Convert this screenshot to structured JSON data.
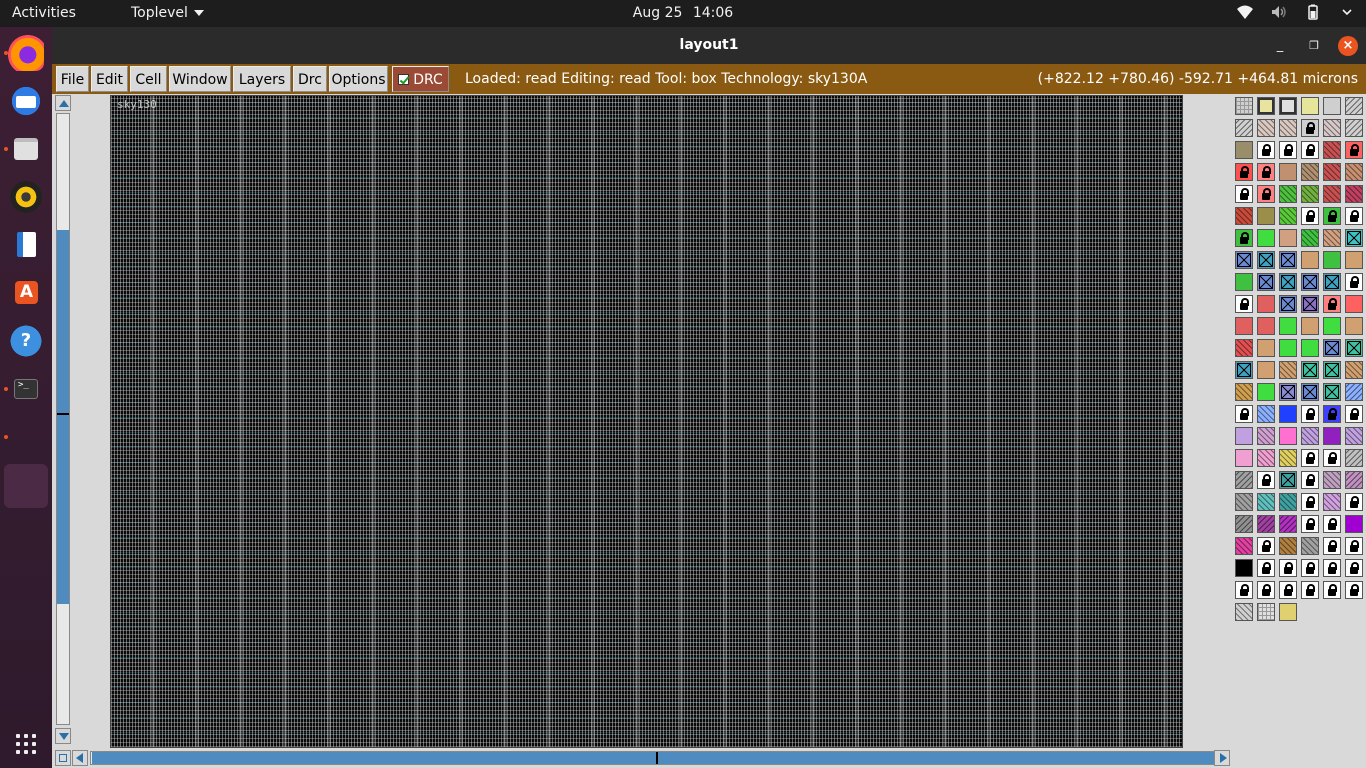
{
  "topbar": {
    "activities": "Activities",
    "app_menu": "Toplevel",
    "date": "Aug 25",
    "time": "14:06",
    "tray_icons": [
      "wifi-icon",
      "volume-icon",
      "battery-icon",
      "power-menu-icon"
    ]
  },
  "dock": {
    "items": [
      {
        "name": "firefox",
        "color": "#ff7139",
        "running": true
      },
      {
        "name": "thunderbird",
        "color": "#3a7bd5",
        "running": false
      },
      {
        "name": "files",
        "color": "#d8d8d8",
        "running": true
      },
      {
        "name": "rhythmbox",
        "color": "#f5c211",
        "running": false
      },
      {
        "name": "libreoffice-writer",
        "color": "#3f8ae0",
        "running": false
      },
      {
        "name": "ubuntu-software",
        "color": "#e95420",
        "running": false
      },
      {
        "name": "help",
        "color": "#3d8fe0",
        "running": false
      },
      {
        "name": "terminal",
        "color": "#3a3a3a",
        "running": true
      },
      {
        "name": "blank",
        "color": "",
        "running": true
      },
      {
        "name": "magic-window",
        "color": "#5a3a50",
        "running": true
      }
    ],
    "show_apps_icon": "grid-icon"
  },
  "window": {
    "title": "layout1",
    "controls": {
      "minimize": "_",
      "maximize": "❐",
      "close": "×"
    }
  },
  "menubar": {
    "items": [
      "File",
      "Edit",
      "Cell",
      "Window",
      "Layers",
      "Drc",
      "Options"
    ],
    "drc_toggle": {
      "label": "DRC",
      "checked": true
    },
    "status": "Loaded: read Editing: read Tool: box  Technology: sky130A",
    "coords": "(+822.12 +780.46) -592.71 +464.81 microns"
  },
  "canvas": {
    "label": "sky130"
  },
  "palette": {
    "columns": 6,
    "swatches": [
      [
        "#cfcfcf/grid",
        "#e8e4a0/box",
        "#e0e0e0/box",
        "#e6e69a/plain",
        "#cfcfcf/plain",
        "#d0d0d0/bhatch"
      ],
      [
        "#d0d0d0/bhatch",
        "#d8c8c0/hatch",
        "#d8c8c0/hatch",
        "#cfcfcf/lock",
        "#d6c8c8/hatch",
        "#d0d0d0/bhatch"
      ],
      [
        "#9a8e6a/plain",
        "#ffffff/lock",
        "#ffffff/lock",
        "#ffffff/lock",
        "#c85050/hatch",
        "#ff6060/lock"
      ],
      [
        "#ff5050/lock",
        "#ff8080/lock",
        "#c09070/plain",
        "#b09070/hatch",
        "#c85050/hatch",
        "#c89070/hatch"
      ],
      [
        "#ffffff/lock",
        "#ff8080/lock",
        "#4fc040/hatch",
        "#70b040/hatch",
        "#c85050/hatch",
        "#c04060/hatch"
      ],
      [
        "#c84a3a/hatch",
        "#9a8e4a/plain",
        "#5aca3a/hatch",
        "#ffffff/lock",
        "#40c040/lock",
        "#ffffff/lock"
      ],
      [
        "#40c040/lock",
        "#40dd40/plain",
        "#d0a080/plain",
        "#40c040/hatch",
        "#d0a080/hatch",
        "#40c0c0/xbox"
      ],
      [
        "#6a8ad0/xbox",
        "#40a0c0/xbox",
        "#6a8ad0/xbox",
        "#d0a070/plain",
        "#40c040/plain",
        "#d0a070/plain"
      ],
      [
        "#40c040/plain",
        "#6a8ad0/xbox",
        "#40a0c0/xbox",
        "#6a8ad0/xbox",
        "#40a0c0/xbox",
        "#ffffff/lock"
      ],
      [
        "#ffffff/lock",
        "#e06060/plain",
        "#6a8ad0/xbox",
        "#8a70c0/xbox",
        "#ff8080/lock",
        "#ff6060/plain"
      ],
      [
        "#e06060/plain",
        "#e06060/plain",
        "#40dd40/plain",
        "#d0a070/plain",
        "#40dd40/plain",
        "#d0a070/plain"
      ],
      [
        "#e05050/hatch",
        "#d0a070/plain",
        "#40dd40/plain",
        "#40dd40/plain",
        "#6a8ad0/xbox",
        "#40c0a0/xbox"
      ],
      [
        "#40a0c0/xbox",
        "#d0a070/plain",
        "#d0a070/hatch",
        "#40c0a0/xbox",
        "#40c0a0/xbox",
        "#d0a070/hatch"
      ],
      [
        "#d0a050/hatch",
        "#40dd40/plain",
        "#8a8ad0/xbox",
        "#6a8ad0/xbox",
        "#40c0a0/xbox",
        "#8ab0ff/bhatch"
      ],
      [
        "#ffffff/lock",
        "#8ab0ff/hatch",
        "#2040ff/plain",
        "#ffffff/lock",
        "#4040ff/lock",
        "#ffffff/lock"
      ],
      [
        "#c0a0e0/plain",
        "#d0a0d0/hatch",
        "#ff70d0/plain",
        "#c0a0e0/hatch",
        "#9020c0/plain",
        "#c0a0e0/hatch"
      ],
      [
        "#f0a0d0/plain",
        "#f0a0d0/hatch",
        "#e0d060/hatch",
        "#ffffff/lock",
        "#ffffff/lock",
        "#c0c0c0/bhatch"
      ],
      [
        "#a0a0a0/bhatch",
        "#ffffff/lock",
        "#40a0a0/xbox",
        "#ffffff/lock",
        "#c0a0c0/hatch",
        "#c090c0/bhatch"
      ],
      [
        "#a0a0a0/hatch",
        "#60c0c0/hatch",
        "#40a0a0/hatch",
        "#ffffff/lock",
        "#d0a0e0/hatch",
        "#ffffff/lock"
      ],
      [
        "#909090/bhatch",
        "#a040a0/bhatch",
        "#b030c0/bhatch",
        "#ffffff/lock",
        "#ffffff/lock",
        "#a000d0/plain"
      ],
      [
        "#e040a0/hatch",
        "#ffffff/lock",
        "#b08040/hatch",
        "#a0a0a0/hatch",
        "#ffffff/lock",
        "#ffffff/lock"
      ],
      [
        "#000000/plain",
        "#ffffff/lock",
        "#ffffff/lock",
        "#ffffff/lock",
        "#ffffff/lock",
        "#ffffff/lock"
      ],
      [
        "#ffffff/lock",
        "#ffffff/lock",
        "#ffffff/lock",
        "#ffffff/lock",
        "#ffffff/lock",
        "#ffffff/lock"
      ],
      [
        "#d0d0d0/hatch",
        "#e0e0e0/grid",
        "#e0d070/plain"
      ]
    ]
  },
  "scrollbars": {
    "vertical_fill": 0.61,
    "horizontal_fill": 1.0
  }
}
